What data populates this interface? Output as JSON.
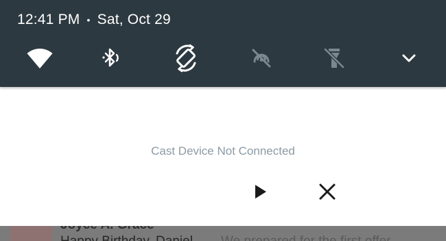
{
  "status_bar": {
    "time": "12:41 PM",
    "separator": "•",
    "date": "Sat, Oct 29"
  },
  "quick_settings": [
    {
      "name": "wifi-icon",
      "state": "on"
    },
    {
      "name": "bluetooth-icon",
      "state": "on"
    },
    {
      "name": "auto-rotate-icon",
      "state": "on"
    },
    {
      "name": "cast-off-icon",
      "state": "off"
    },
    {
      "name": "flashlight-off-icon",
      "state": "off"
    },
    {
      "name": "chevron-down-icon",
      "state": "expand"
    }
  ],
  "cast_card": {
    "status_text": "Cast Device Not Connected",
    "play_icon": "play-icon",
    "close_icon": "close-icon"
  },
  "underlying_notification": {
    "title": "Joyce A. Grace",
    "text": "Happy Birthday, Daniel",
    "faded_text": "We prepared for the first offer"
  },
  "colors": {
    "shade_background": "#2d3940",
    "icon_active": "#ffffff",
    "icon_inactive": "#7c878e",
    "status_text": "#8d9aa3",
    "card_background": "#ffffff",
    "dim_overlay": "#7b7b7b"
  }
}
